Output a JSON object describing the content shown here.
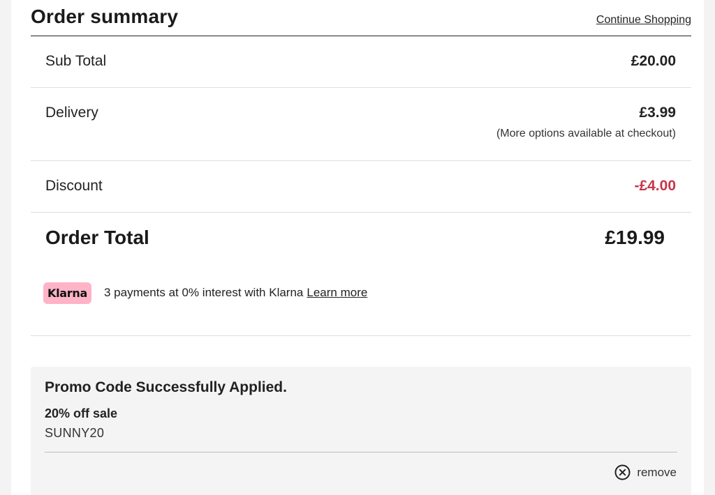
{
  "header": {
    "title": "Order summary",
    "continue_label": "Continue Shopping"
  },
  "summary": {
    "subtotal_label": "Sub Total",
    "subtotal_value": "£20.00",
    "delivery_label": "Delivery",
    "delivery_value": "£3.99",
    "delivery_note": "(More options available at checkout)",
    "discount_label": "Discount",
    "discount_value": "-£4.00",
    "order_total_label": "Order Total",
    "order_total_value": "£19.99"
  },
  "klarna": {
    "badge": "Klarna",
    "text": "3 payments at 0% interest with Klarna",
    "learn_more": "Learn more",
    "badge_color": "#ffb3c7"
  },
  "promo": {
    "title": "Promo Code Successfully Applied.",
    "name": "20% off sale",
    "code": "SUNNY20",
    "remove_label": "remove",
    "remove_icon": "close-circle-icon"
  },
  "colors": {
    "discount": "#c9354a",
    "promo_background": "#f4f4f4",
    "divider": "#dedede"
  }
}
